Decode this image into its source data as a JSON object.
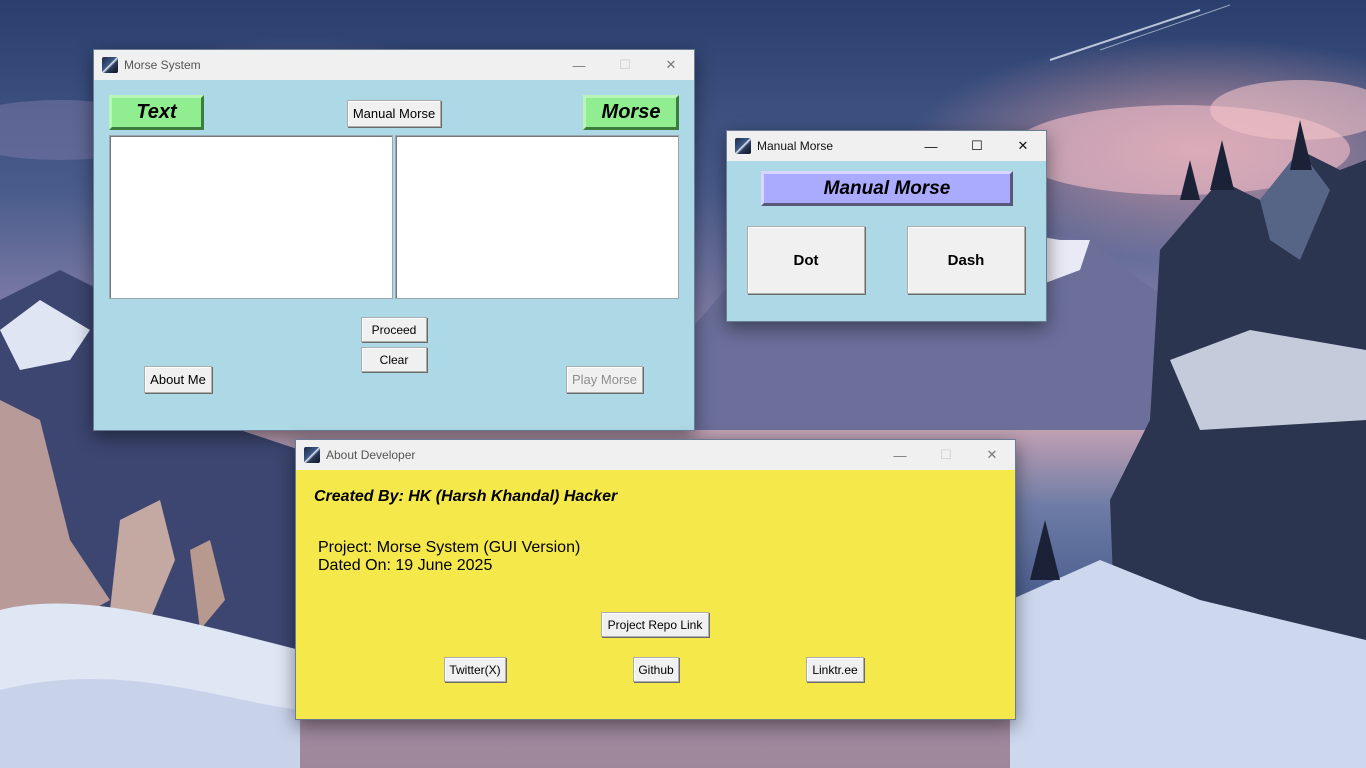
{
  "colors": {
    "morse_bg": "#add8e6",
    "label_green": "#90ee90",
    "manual_label": "#aaaaff",
    "about_bg": "#f5e84a",
    "titlebar": "#f0f0f0"
  },
  "morse_window": {
    "title": "Morse System",
    "text_label": "Text",
    "morse_label": "Morse",
    "manual_morse_button": "Manual Morse",
    "text_input_value": "",
    "morse_output_value": "",
    "proceed_button": "Proceed",
    "clear_button": "Clear",
    "about_button": "About Me",
    "play_button": "Play Morse"
  },
  "manual_window": {
    "title": "Manual Morse",
    "heading": "Manual Morse",
    "dot_button": "Dot",
    "dash_button": "Dash"
  },
  "about_window": {
    "title": "About Developer",
    "creator": "Created By: HK (Harsh Khandal) Hacker",
    "project_line": "Project: Morse System (GUI Version)",
    "date_line": "Dated On: 19 June 2025",
    "repo_button": "Project Repo Link",
    "twitter_button": "Twitter(X)",
    "github_button": "Github",
    "linktree_button": "Linktr.ee"
  },
  "window_controls": {
    "minimize_icon": "minimize-icon",
    "maximize_icon": "maximize-icon",
    "close_icon": "close-icon",
    "minimize_glyph": "—",
    "maximize_glyph": "☐",
    "close_glyph": "✕"
  }
}
